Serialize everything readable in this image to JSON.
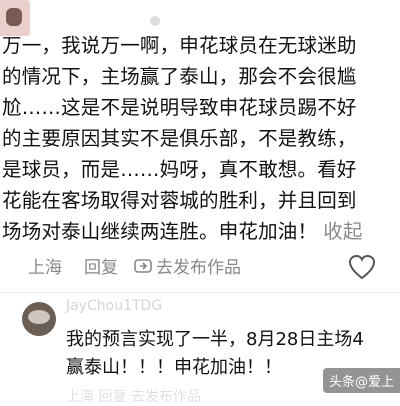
{
  "comment": {
    "lines": [
      "万一，我说万一啊，申花球员在无球迷助",
      "的情况下，主场赢了泰山，那会不会很尴",
      "尬……这是不是说明导致申花球员踢不好",
      "的主要原因其实不是俱乐部，不是教练，",
      "是球员，而是……妈呀，真不敢想。看好",
      "花能在客场取得对蓉城的胜利，并且回到",
      "场场对泰山继续两连胜。申花加油！"
    ],
    "fold_label": "收起",
    "location": "上海",
    "reply_label": "回复",
    "share_label": "去发布作品"
  },
  "reply": {
    "username": "JayChou1TDG",
    "lines": [
      "我的预言实现了一半，8月28日主场4",
      "赢泰山！！！申花加油！！"
    ],
    "meta": "上海  回复  去发布作品"
  },
  "watermark": "头条@爱上"
}
